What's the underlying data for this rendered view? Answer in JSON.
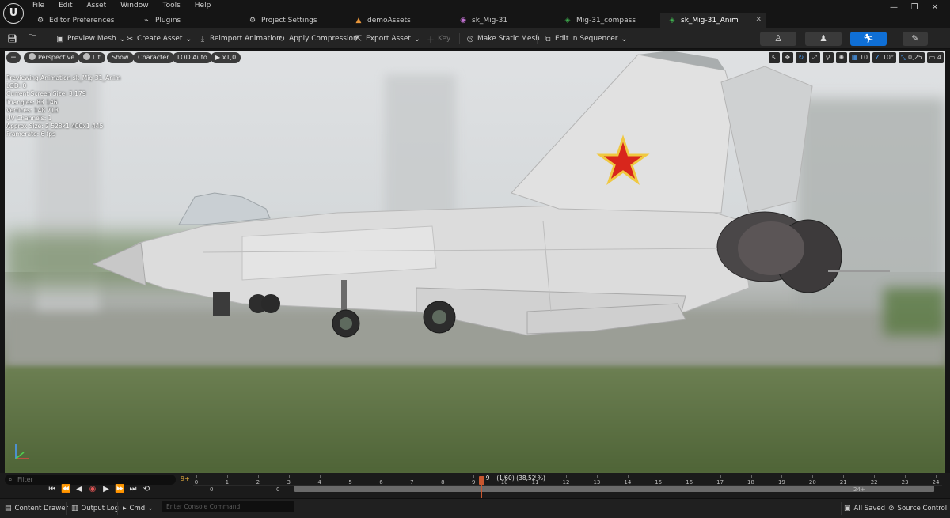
{
  "app": {
    "logo_text": "U",
    "menu": [
      "File",
      "Edit",
      "Asset",
      "Window",
      "Tools",
      "Help"
    ],
    "window_controls": [
      "—",
      "❐",
      "✕"
    ]
  },
  "tabs": [
    {
      "label": "Editor Preferences",
      "icon": "gear-icon",
      "active": false
    },
    {
      "label": "Plugins",
      "icon": "plug-icon",
      "active": false
    },
    {
      "label": "Project Settings",
      "icon": "settings-icon",
      "active": false
    },
    {
      "label": "demoAssets",
      "icon": "folder-icon",
      "active": false
    },
    {
      "label": "sk_Mig-31",
      "icon": "skeleton-icon",
      "active": false
    },
    {
      "label": "Mig-31_compass",
      "icon": "anim-icon",
      "active": false
    },
    {
      "label": "sk_Mig-31_Anim",
      "icon": "anim-icon",
      "active": true
    }
  ],
  "toolbar": {
    "preview_mesh": "Preview Mesh",
    "create_asset": "Create Asset",
    "reimport": "Reimport Animation",
    "apply_compression": "Apply Compression",
    "export_asset": "Export Asset",
    "key": "Key",
    "make_static_mesh": "Make Static Mesh",
    "edit_in_sequencer": "Edit in Sequencer"
  },
  "viewport": {
    "pills": [
      "Perspective",
      "Lit",
      "Show",
      "Character",
      "LOD Auto",
      "x1,0"
    ],
    "stats": [
      "Previewing Animation sk_Mig-31_Anim",
      "LOD: 0",
      "Current Screen Size: 3,179",
      "Triangles: 83 146",
      "Vertices: 148 713",
      "UV Channels: 1",
      "Approx Size: 2 528x1 400x1 445",
      "Framerate: 6 fps"
    ],
    "grid_snap": "10",
    "rotation_snap": "10°",
    "scale_snap": "0,25",
    "camera_speed": "4",
    "star_color": "#d8261c",
    "star_outline_color": "#f0c840"
  },
  "timeline": {
    "filter_placeholder": "Filter",
    "filter_count": "9+",
    "playhead": "9+ (1,60) (38,52 %)",
    "range_start": "0",
    "range_view_start": "0",
    "range_end": "24+",
    "ticks": [
      "0",
      "1",
      "2",
      "3",
      "4",
      "5",
      "6",
      "7",
      "8",
      "9",
      "10",
      "11",
      "12",
      "13",
      "14",
      "15",
      "16",
      "17",
      "18",
      "19",
      "20",
      "21",
      "22",
      "23",
      "24"
    ],
    "playhead_fraction": 0.3852
  },
  "statusbar": {
    "content_drawer": "Content Drawer",
    "output_log": "Output Log",
    "cmd": "Cmd",
    "console_placeholder": "Enter Console Command",
    "all_saved": "All Saved",
    "source_control": "Source Control"
  }
}
